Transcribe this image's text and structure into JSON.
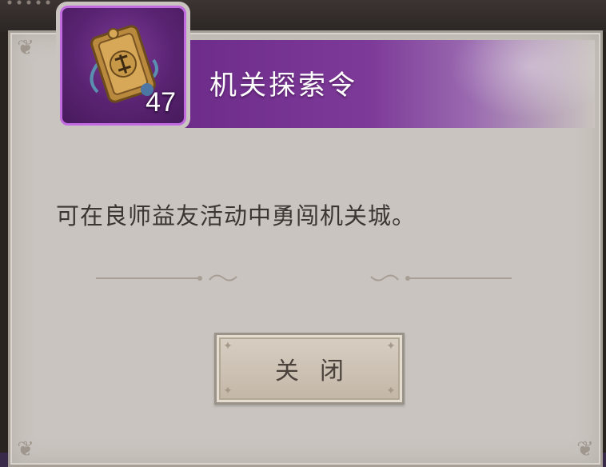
{
  "dialog": {
    "item_name": "机关探索令",
    "item_count": "47",
    "item_icon": "gear-token-icon",
    "description": "可在良师益友活动中勇闯机关城。",
    "close_label": "关闭"
  },
  "colors": {
    "rarity_purple": "#6e2c8a",
    "panel_bg": "#c9c4bf",
    "text_dark": "#3b3633"
  }
}
